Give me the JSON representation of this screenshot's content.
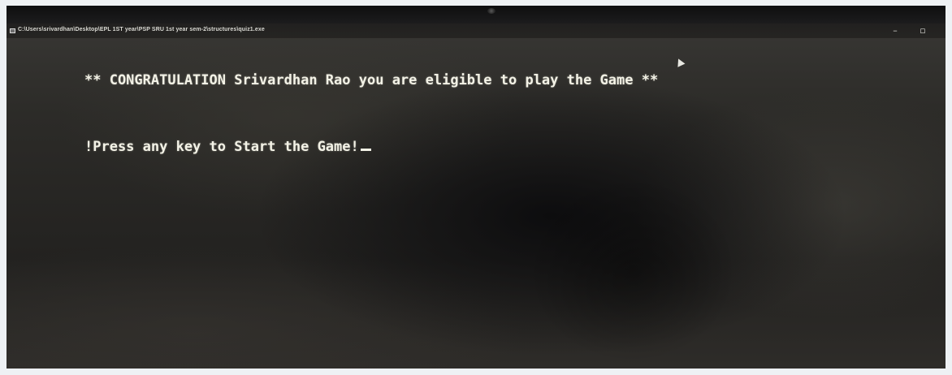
{
  "window": {
    "title": "C:\\Users\\srivardhan\\Desktop\\EPL 1ST year\\PSP SRU 1st year sem-2\\structures\\quiz1.exe",
    "minimize_glyph": "–",
    "maximize_glyph": "▫",
    "console_icon": "console-window-icon"
  },
  "console": {
    "line1": "** CONGRATULATION Srivardhan Rao you are eligible to play the Game **",
    "line2": "!Press any key to Start the Game!"
  },
  "colors": {
    "console_text": "#f3f2e6",
    "console_background": "#242424",
    "frame_background": "#eef1f4"
  }
}
